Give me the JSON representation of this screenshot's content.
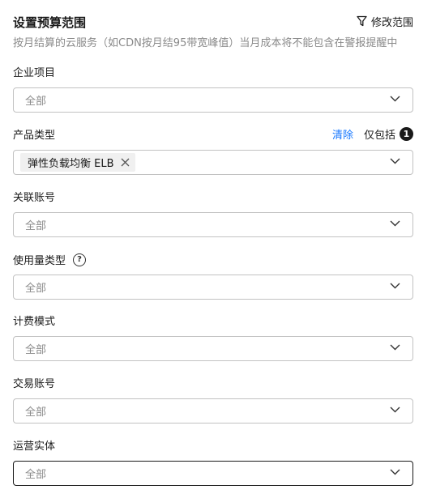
{
  "header": {
    "title": "设置预算范围",
    "modify_label": "修改范围",
    "subtitle": "按月结算的云服务（如CDN按月结95带宽峰值）当月成本将不能包含在警报提醒中"
  },
  "fields": {
    "enterprise_project": {
      "label": "企业项目",
      "value": "全部"
    },
    "product_type": {
      "label": "产品类型",
      "clear_label": "清除",
      "only_include_label": "仅包括",
      "count": "1",
      "tag": "弹性负载均衡 ELB"
    },
    "linked_account": {
      "label": "关联账号",
      "value": "全部"
    },
    "usage_type": {
      "label": "使用量类型",
      "help": "?",
      "value": "全部"
    },
    "billing_mode": {
      "label": "计费模式",
      "value": "全部"
    },
    "transaction_account": {
      "label": "交易账号",
      "value": "全部"
    },
    "operating_entity": {
      "label": "运营实体",
      "value": "全部"
    }
  }
}
